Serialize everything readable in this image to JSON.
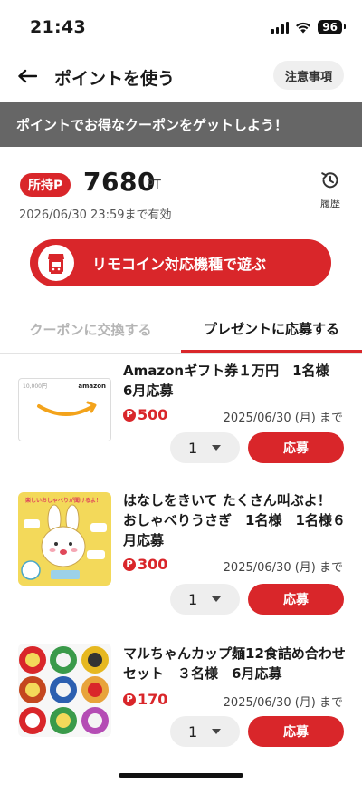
{
  "status_bar": {
    "time": "21:43",
    "battery": "96"
  },
  "header": {
    "title": "ポイントを使う",
    "notice_label": "注意事項"
  },
  "banner": {
    "text": "ポイントでお得なクーポンをゲットしよう！"
  },
  "points": {
    "owned_label": "所持P",
    "value": "7680",
    "unit": "PT",
    "expiry": "2026/06/30 23:59まで有効",
    "history_label": "履歴"
  },
  "remocoin": {
    "label": "リモコイン対応機種で遊ぶ"
  },
  "tabs": [
    {
      "label": "クーポンに交換する",
      "active": false
    },
    {
      "label": "プレゼントに応募する",
      "active": true
    }
  ],
  "items": [
    {
      "title_line1": "Amazonギフト券１万円　1名様",
      "title_line2": "6月応募",
      "title_line3": "",
      "cost": "500",
      "deadline": "2025/06/30 (月) まで",
      "qty": "1",
      "apply_label": "応募",
      "thumb_text": "10,000円",
      "thumb_brand": "amazon"
    },
    {
      "title_line1": "はなしをきいて たくさん叫ぶよ！",
      "title_line2": "おしゃべりうさぎ　1名様　1名様６",
      "title_line3": "月応募",
      "cost": "300",
      "deadline": "2025/06/30 (月) まで",
      "qty": "1",
      "apply_label": "応募",
      "thumb_text": "楽しいおしゃべりが聞けるよ！"
    },
    {
      "title_line1": "マルちゃんカップ麺12食詰め合わせ",
      "title_line2": "セット　３名様　6月応募",
      "title_line3": "",
      "cost": "170",
      "deadline": "2025/06/30 (月) まで",
      "qty": "1",
      "apply_label": "応募"
    }
  ],
  "colors": {
    "accent": "#d9262a",
    "banner": "#666666",
    "inactive_tab": "#b5b5b5"
  }
}
